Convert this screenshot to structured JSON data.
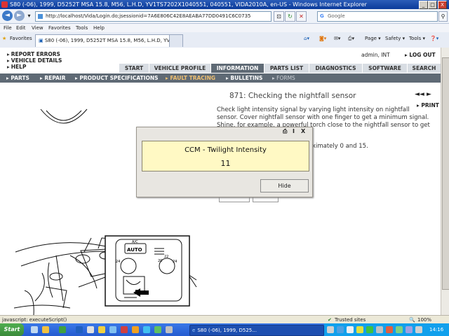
{
  "window": {
    "title": "S80 (-06), 1999, D5252T MSA 15.8, M56, L.H.D, YV1TS7202X1040551, 040551, VIDA2010A, en-US - Windows Internet Explorer",
    "buttons": [
      "_",
      "□",
      "X"
    ]
  },
  "browser": {
    "url": "http://localhost/Vida/Login.do;jsessionid=7A6E806C42E8AEABA77DD0491C6C0735",
    "search_placeholder": "Google",
    "menu": [
      "File",
      "Edit",
      "View",
      "Favorites",
      "Tools",
      "Help"
    ],
    "favorites_label": "Favorites",
    "tab_label": "S80 (-06), 1999, D5252T MSA 15.8, M56, L.H.D, YV1...",
    "toolbar": {
      "page": "Page ▾",
      "safety": "Safety ▾",
      "tools": "Tools ▾",
      "help": "❓▾"
    }
  },
  "app": {
    "links": [
      "REPORT ERRORS",
      "VEHICLE DETAILS",
      "HELP"
    ],
    "user": "admin, INT",
    "logout": "LOG OUT",
    "tabs": [
      {
        "label": "START",
        "active": false
      },
      {
        "label": "VEHICLE PROFILE",
        "active": false
      },
      {
        "label": "INFORMATION",
        "active": true
      },
      {
        "label": "PARTS LIST",
        "active": false
      },
      {
        "label": "DIAGNOSTICS",
        "active": false
      },
      {
        "label": "SOFTWARE",
        "active": false
      },
      {
        "label": "SEARCH",
        "active": false
      }
    ],
    "subnav": [
      {
        "label": "PARTS",
        "state": "normal"
      },
      {
        "label": "REPAIR",
        "state": "normal"
      },
      {
        "label": "PRODUCT SPECIFICATIONS",
        "state": "normal"
      },
      {
        "label": "FAULT TRACING",
        "state": "active"
      },
      {
        "label": "BULLETINS",
        "state": "normal"
      },
      {
        "label": "FORMS",
        "state": "dim"
      }
    ],
    "heading": "871: Checking the nightfall sensor",
    "print": "PRINT",
    "nav_arrows": "◄◄  ►",
    "instruction": "Check light intensity signal by varying light intensity on nightfall sensor. Cover nightfall sensor with one finger to get a minimum signal. Shine, for example, a powerful torch close to the nightfall sensor to get a maximum",
    "instruction_tail": "oximately 0 and 15.",
    "illustration_labels": {
      "auto": "AUTO",
      "ac_small": "A/C",
      "dial_left": "24",
      "dial_right": "24",
      "dial_left_mid": "20",
      "dial_right_mid": "20",
      "dial_top": "22"
    }
  },
  "dialog": {
    "title": "CCM - Twilight Intensity",
    "value": "11",
    "hide": "Hide",
    "icons": [
      "print-icon",
      "info-icon",
      "close-icon"
    ]
  },
  "statusbar": {
    "left": "javascript: executeScript()",
    "zone": "Trusted sites",
    "zoom": "100%"
  },
  "taskbar": {
    "start": "Start",
    "task": "S80 (-06), 1999, D525...",
    "clock": "14:16"
  },
  "colors": {
    "titlebar": "#0a3a9a",
    "active_tab": "#5f6a75",
    "subnav_active": "#f0c070",
    "dialog_panel": "#fff9c4"
  }
}
